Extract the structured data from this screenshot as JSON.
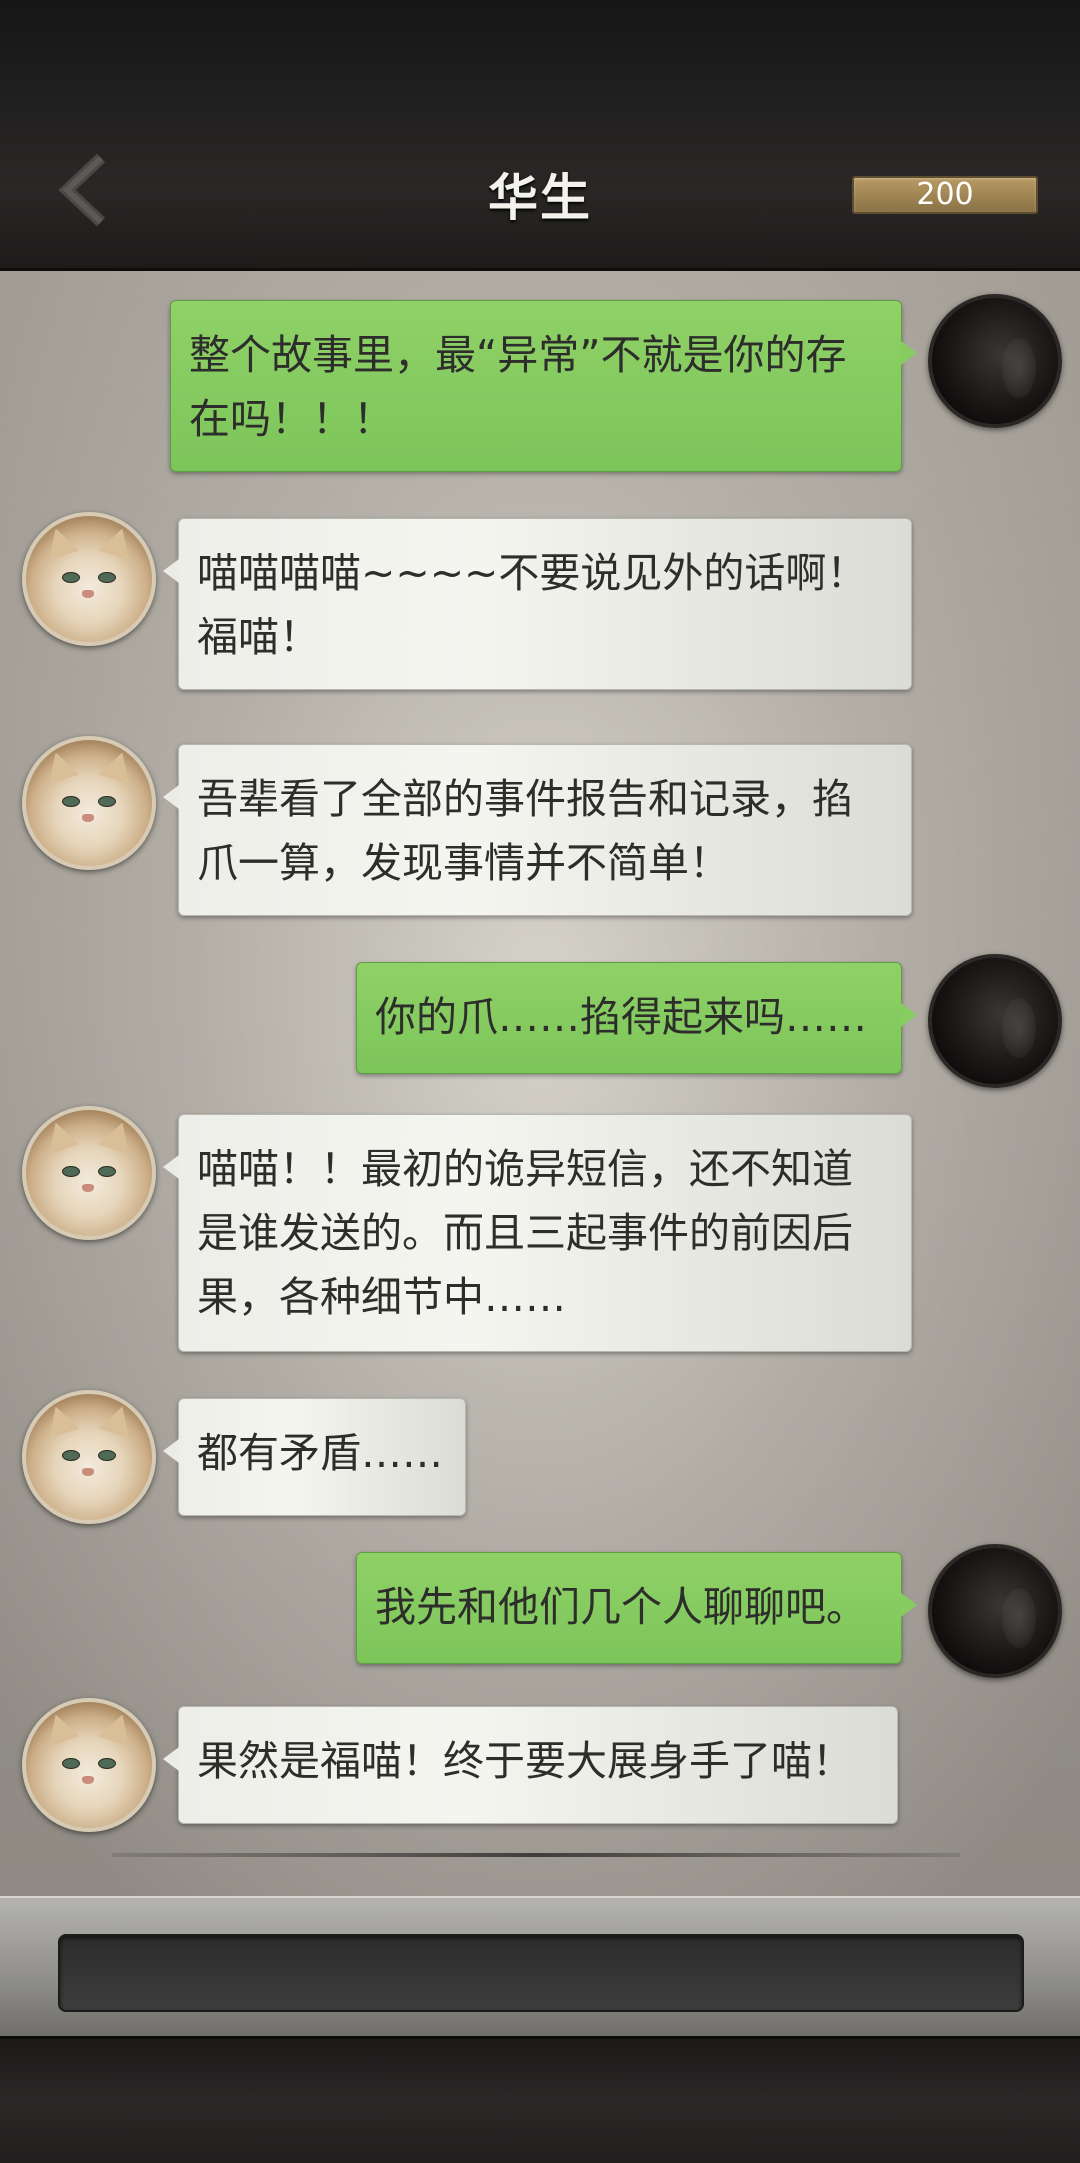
{
  "header": {
    "title": "华生",
    "coins": "200",
    "back_icon": "chevron-left-icon"
  },
  "messages": [
    {
      "side": "right",
      "text": "整个故事里，最“异常”不就是你的存在吗！！！"
    },
    {
      "side": "left",
      "text": "喵喵喵喵~~~~不要说见外的话啊！福喵！"
    },
    {
      "side": "left",
      "text": "吾辈看了全部的事件报告和记录，掐爪一算，发现事情并不简单！"
    },
    {
      "side": "right",
      "text": "你的爪……掐得起来吗……"
    },
    {
      "side": "left",
      "text": "喵喵！！最初的诡异短信，还不知道是谁发送的。而且三起事件的前因后果，各种细节中……"
    },
    {
      "side": "left",
      "text": "都有矛盾……"
    },
    {
      "side": "right",
      "text": "我先和他们几个人聊聊吧。"
    },
    {
      "side": "left",
      "text": "果然是福喵！终于要大展身手了喵！"
    }
  ],
  "input": {
    "value": ""
  }
}
